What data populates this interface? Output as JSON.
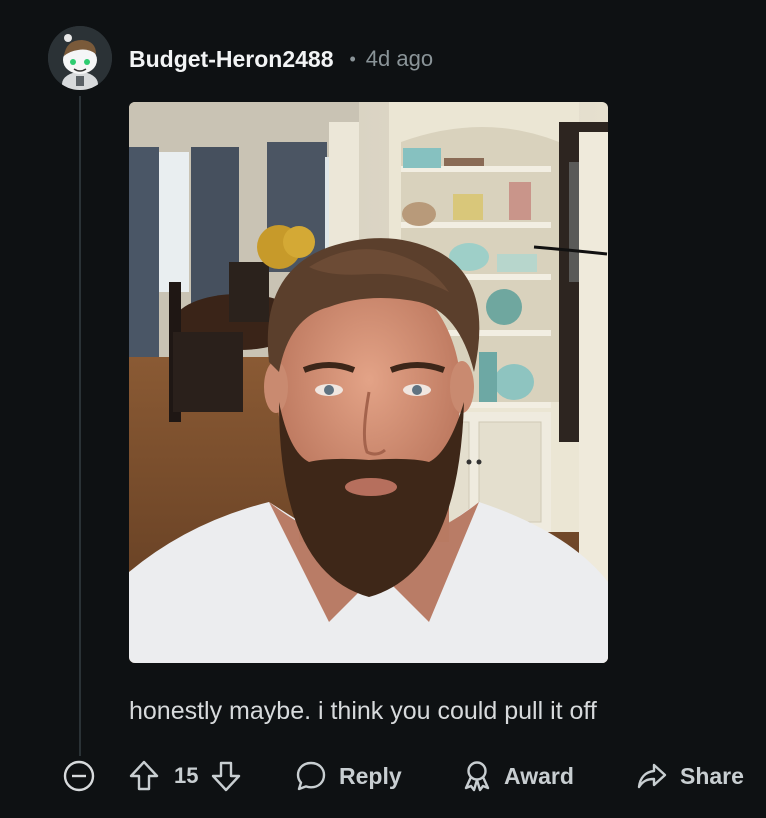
{
  "comment": {
    "author": "Budget-Heron2488",
    "separator": "•",
    "age": "4d ago",
    "body": "honestly maybe. i think you could pull it off",
    "media": {
      "kind": "photo",
      "subject": "selfie-bearded-man-dining-room"
    }
  },
  "actions": {
    "collapse_icon": "collapse-minus-icon",
    "upvote_icon": "arrow-up-icon",
    "score": "15",
    "downvote_icon": "arrow-down-icon",
    "reply_label": "Reply",
    "reply_icon": "speech-bubble-icon",
    "award_label": "Award",
    "award_icon": "award-ribbon-icon",
    "share_label": "Share",
    "share_icon": "share-arrow-icon"
  },
  "colors": {
    "background": "#0e1113",
    "text": "#d7dadc",
    "muted": "#8a9498",
    "thread_line": "#2a3236"
  }
}
